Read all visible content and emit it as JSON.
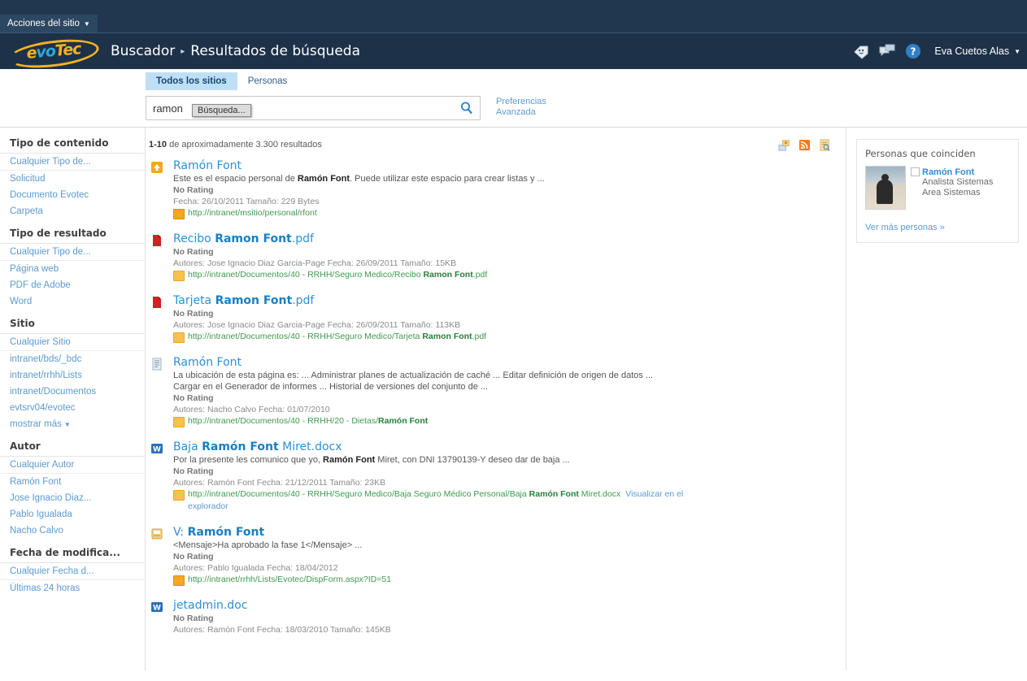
{
  "chrome": {
    "site_actions": "Acciones del sitio",
    "logo_parts": {
      "e": "e",
      "vo": "vo",
      "tec": "Tec"
    },
    "breadcrumb_root": "Buscador",
    "breadcrumb_sep": "▸",
    "breadcrumb_current": "Resultados de búsqueda",
    "icons": [
      "tag-icon",
      "note-board-icon",
      "help-icon"
    ],
    "user_name": "Eva Cuetos Alas",
    "caret": "▼"
  },
  "search": {
    "tabs": [
      {
        "label": "Todos los sitios",
        "active": true
      },
      {
        "label": "Personas",
        "active": false
      }
    ],
    "query_value": "ramon",
    "tooltip": "Búsqueda...",
    "go_icon": "search-icon",
    "prefs_line1": "Preferencias",
    "prefs_line2": "Avanzada"
  },
  "refine": {
    "groups": [
      {
        "title": "Tipo de contenido",
        "any": "Cualquier Tipo de...",
        "items": [
          "Solicitud",
          "Documento Evotec",
          "Carpeta"
        ],
        "more": null
      },
      {
        "title": "Tipo de resultado",
        "any": "Cualquier Tipo de...",
        "items": [
          "Página web",
          "PDF de Adobe",
          "Word"
        ],
        "more": null
      },
      {
        "title": "Sitio",
        "any": "Cualquier Sitio",
        "items": [
          "intranet/bds/_bdc",
          "intranet/rrhh/Lists",
          "intranet/Documentos",
          "evtsrv04/evotec"
        ],
        "more": "mostrar más"
      },
      {
        "title": "Autor",
        "any": "Cualquier Autor",
        "items": [
          "Ramón Font",
          "Jose Ignacio Diaz...",
          "Pablo Igualada",
          "Nacho Calvo"
        ],
        "more": null
      },
      {
        "title": "Fecha de modifica...",
        "any": "Cualquier Fecha d...",
        "items": [
          "Últimas 24 horas"
        ],
        "more": null
      }
    ]
  },
  "results_header": {
    "range": "1-10",
    "count_text": " de aproximadamente 3.300 resultados",
    "actions": [
      "alert-me-icon",
      "rss-feed-icon",
      "search-results-icon"
    ]
  },
  "results": [
    {
      "icon": "sharepoint-site-icon",
      "title_plain": "Ramón Font",
      "snippet_pre": "Este es el espacio personal de ",
      "snippet_bold": "Ramón Font",
      "snippet_post": ". Puede utilizar este espacio para crear listas y ...",
      "rating": "No Rating",
      "meta": "Fecha: 26/10/2011    Tamaño: 229 Bytes",
      "url_pre": "http://intranet/msitio/personal/rfont",
      "url_bold": "",
      "url_post": "",
      "chip": "sp",
      "explorer": ""
    },
    {
      "icon": "pdf-icon",
      "title_pre": "Recibo ",
      "title_bold": "Ramon Font",
      "title_post": ".pdf",
      "snippet_pre": "",
      "snippet_bold": "",
      "snippet_post": "",
      "rating": "No Rating",
      "meta": "Autores: Jose Ignacio Diaz Garcia-Page    Fecha: 26/09/2011    Tamaño: 15KB",
      "url_pre": "http://intranet/Documentos/40 - RRHH/Seguro Medico/Recibo ",
      "url_bold": "Ramon Font",
      "url_post": ".pdf",
      "chip": "doc",
      "explorer": ""
    },
    {
      "icon": "pdf-icon",
      "title_pre": "Tarjeta ",
      "title_bold": "Ramon Font",
      "title_post": ".pdf",
      "snippet_pre": "",
      "snippet_bold": "",
      "snippet_post": "",
      "rating": "No Rating",
      "meta": "Autores: Jose Ignacio Diaz Garcia-Page    Fecha: 26/09/2011    Tamaño: 113KB",
      "url_pre": "http://intranet/Documentos/40 - RRHH/Seguro Medico/Tarjeta ",
      "url_bold": "Ramon Font",
      "url_post": ".pdf",
      "chip": "doc",
      "explorer": ""
    },
    {
      "icon": "page-icon",
      "title_plain": "Ramón Font",
      "snippet_pre": "La ubicación de esta página es: ... Administrar planes de actualización de caché ... Editar definición de origen de datos ... Cargar en el Generador de informes ... Historial de versiones del conjunto de ...",
      "snippet_bold": "",
      "snippet_post": "",
      "rating": "No Rating",
      "meta": "Autores: Nacho Calvo    Fecha: 01/07/2010",
      "url_pre": "http://intranet/Documentos/40 - RRHH/20 - Dietas/",
      "url_bold": "Ramón Font",
      "url_post": "",
      "chip": "doc",
      "explorer": ""
    },
    {
      "icon": "word-icon",
      "title_pre": "Baja ",
      "title_bold": "Ramón Font",
      "title_post": " Miret.docx",
      "snippet_pre": "Por la presente les comunico que yo, ",
      "snippet_bold": "Ramón Font",
      "snippet_post": " Miret, con DNI 13790139-Y deseo dar de baja ...",
      "rating": "No Rating",
      "meta": "Autores: Ramón Font    Fecha: 21/12/2011    Tamaño: 23KB",
      "url_pre": "http://intranet/Documentos/40 - RRHH/Seguro Medico/Baja Seguro Médico Personal/Baja ",
      "url_bold": "Ramón Font",
      "url_post": " Miret.docx",
      "chip": "doc",
      "explorer": "Visualizar en el explorador"
    },
    {
      "icon": "list-item-icon",
      "title_pre": "V: ",
      "title_bold": "Ramón Font",
      "title_post": "",
      "snippet_pre": "<Mensaje>Ha aprobado la fase 1</Mensaje> ...",
      "snippet_bold": "",
      "snippet_post": "",
      "rating": "No Rating",
      "meta": "Autores: Pablo Igualada    Fecha: 18/04/2012",
      "url_pre": "http://intranet/rrhh/Lists/Evotec/DispForm.aspx?ID=51",
      "url_bold": "",
      "url_post": "",
      "chip": "sp",
      "explorer": ""
    },
    {
      "icon": "word-icon",
      "title_plain": "jetadmin.doc",
      "snippet_pre": "",
      "snippet_bold": "",
      "snippet_post": "",
      "rating": "No Rating",
      "meta": "Autores: Ramón Font    Fecha: 18/03/2010    Tamaño: 145KB",
      "url_pre": "",
      "url_bold": "",
      "url_post": "",
      "chip": "doc",
      "explorer": ""
    }
  ],
  "people": {
    "title": "Personas que coinciden",
    "name": "Ramón Font",
    "role": "Analista Sistemas",
    "area": "Area Sistemas",
    "more_link": "Ver más personas »"
  }
}
